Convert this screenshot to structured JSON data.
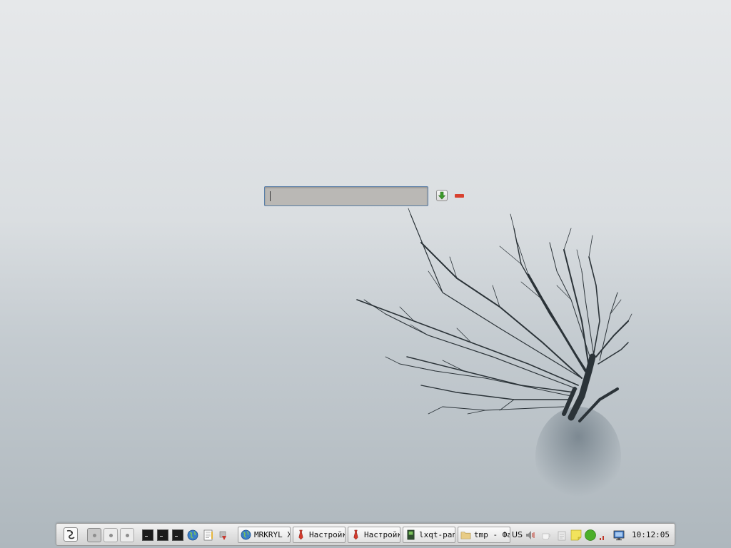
{
  "desktop": {
    "wallpaper_icon": "tree-in-mist",
    "runner": {
      "input_value": "",
      "go_icon": "arrow-down-icon",
      "close_icon": "minus-icon"
    }
  },
  "panel": {
    "menu_icon": "main-menu-icon",
    "desktops": [
      {
        "active": true
      },
      {
        "active": false
      },
      {
        "active": false
      }
    ],
    "quicklaunch": [
      {
        "icon": "terminal-icon"
      },
      {
        "icon": "terminal-icon"
      },
      {
        "icon": "terminal-icon"
      },
      {
        "icon": "globe-icon"
      },
      {
        "icon": "text-editor-icon"
      },
      {
        "icon": "settings-tool-icon"
      }
    ],
    "tasks": [
      {
        "label": "MRKRYL X",
        "icon": "globe-icon"
      },
      {
        "label": "Настройка",
        "icon": "tie-icon"
      },
      {
        "label": "Настройка",
        "icon": "tie-icon"
      },
      {
        "label": "lxqt-pan",
        "icon": "terminal-icon"
      },
      {
        "label": "tmp - Фа",
        "icon": "folder-icon"
      }
    ],
    "keyboard_layout": "US",
    "tray": [
      {
        "icon": "volume-icon"
      },
      {
        "icon": "cup-icon"
      },
      {
        "icon": "clipboard-icon"
      },
      {
        "icon": "note-icon"
      },
      {
        "icon": "status-green-icon"
      },
      {
        "icon": "network-signal-icon"
      },
      {
        "icon": "monitor-icon"
      }
    ],
    "clock": "10:12:05"
  },
  "colors": {
    "accent": "#5a7fa8",
    "close_red": "#d8412f",
    "go_green": "#3c9a2a",
    "status_green": "#4caf2a"
  }
}
